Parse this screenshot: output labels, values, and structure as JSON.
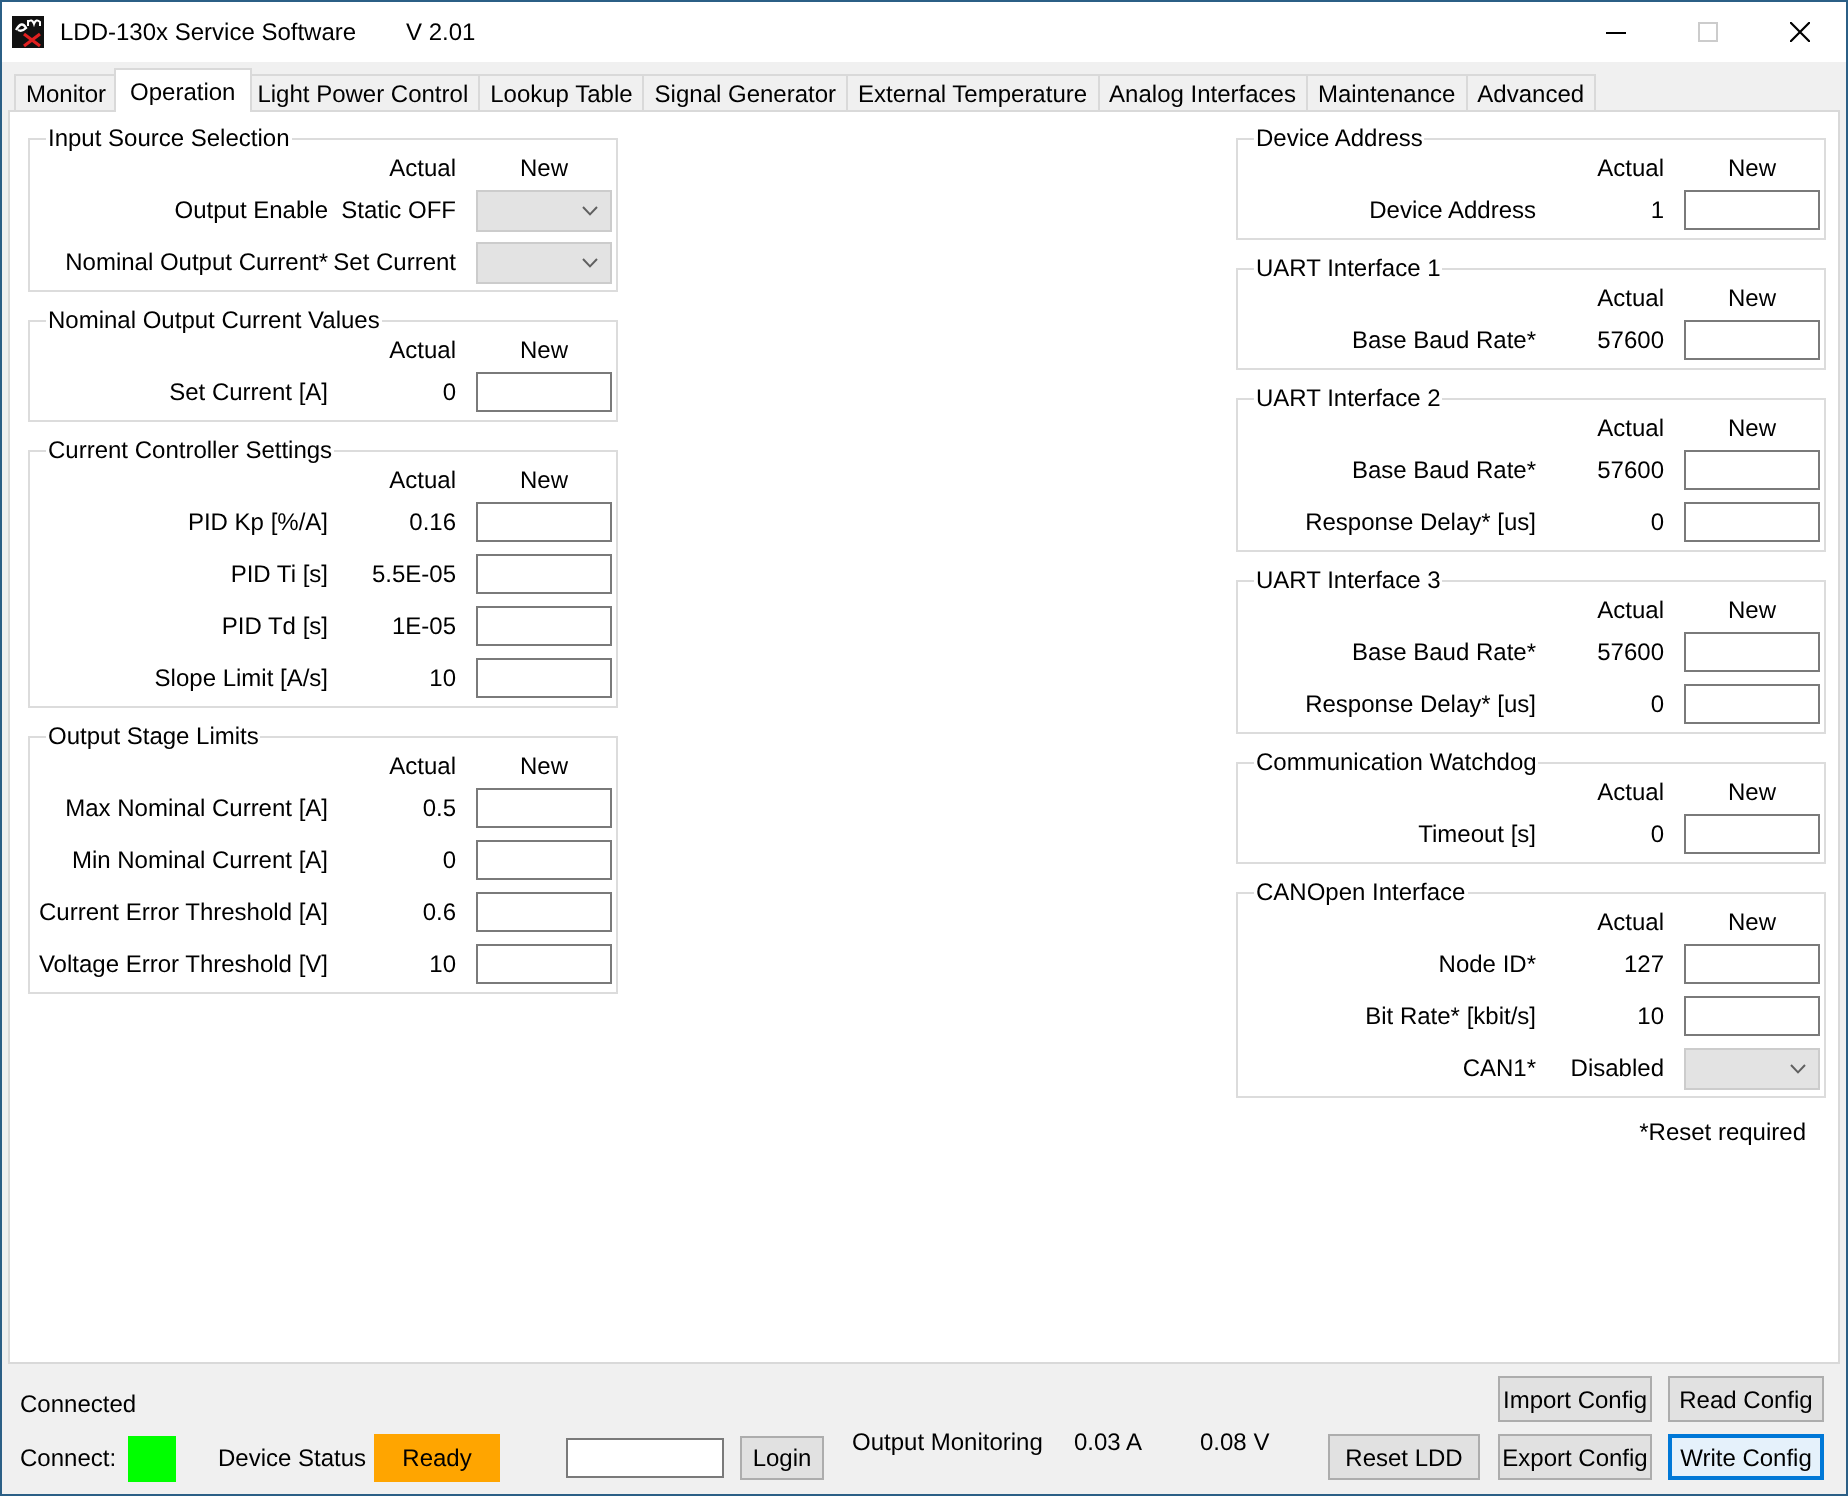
{
  "window": {
    "title": "LDD-130x Service Software",
    "version": "V 2.01",
    "maximize_enabled": false
  },
  "tabs": [
    {
      "label": "Monitor",
      "selected": false
    },
    {
      "label": "Operation",
      "selected": true
    },
    {
      "label": "Light Power Control",
      "selected": false
    },
    {
      "label": "Lookup Table",
      "selected": false
    },
    {
      "label": "Signal Generator",
      "selected": false
    },
    {
      "label": "External Temperature",
      "selected": false
    },
    {
      "label": "Analog Interfaces",
      "selected": false
    },
    {
      "label": "Maintenance",
      "selected": false
    },
    {
      "label": "Advanced",
      "selected": false
    }
  ],
  "left_groups": [
    {
      "title": "Input Source Selection",
      "headers": [
        "Actual",
        "New"
      ],
      "rows": [
        {
          "kind": "dropdown",
          "label": "Output Enable",
          "actual": "Static OFF",
          "disabled": true
        },
        {
          "kind": "dropdown",
          "label": "Nominal Output Current*",
          "actual": "Set Current",
          "disabled": true
        }
      ]
    },
    {
      "title": "Nominal Output Current Values",
      "headers": [
        "Actual",
        "New"
      ],
      "rows": [
        {
          "kind": "input",
          "label": "Set Current [A]",
          "actual": "0",
          "disabled": false
        }
      ]
    },
    {
      "title": "Current Controller Settings",
      "headers": [
        "Actual",
        "New"
      ],
      "rows": [
        {
          "kind": "input",
          "label": "PID Kp [%/A]",
          "actual": "0.16",
          "disabled": false
        },
        {
          "kind": "input",
          "label": "PID Ti [s]",
          "actual": "5.5E-05",
          "disabled": false
        },
        {
          "kind": "input",
          "label": "PID Td [s]",
          "actual": "1E-05",
          "disabled": false
        },
        {
          "kind": "input",
          "label": "Slope Limit [A/s]",
          "actual": "10",
          "disabled": false
        }
      ]
    },
    {
      "title": "Output Stage Limits",
      "headers": [
        "Actual",
        "New"
      ],
      "rows": [
        {
          "kind": "input",
          "label": "Max Nominal Current [A]",
          "actual": "0.5",
          "disabled": false
        },
        {
          "kind": "input",
          "label": "Min Nominal Current [A]",
          "actual": "0",
          "disabled": false
        },
        {
          "kind": "input",
          "label": "Current Error Threshold [A]",
          "actual": "0.6",
          "disabled": false
        },
        {
          "kind": "input",
          "label": "Voltage Error Threshold [V]",
          "actual": "10",
          "disabled": false
        }
      ]
    }
  ],
  "right_groups": [
    {
      "title": "Device Address",
      "headers": [
        "Actual",
        "New"
      ],
      "rows": [
        {
          "kind": "input",
          "label": "Device Address",
          "actual": "1",
          "disabled": false
        }
      ]
    },
    {
      "title": "UART Interface 1",
      "headers": [
        "Actual",
        "New"
      ],
      "rows": [
        {
          "kind": "input",
          "label": "Base Baud Rate*",
          "actual": "57600",
          "disabled": false
        }
      ]
    },
    {
      "title": "UART Interface 2",
      "headers": [
        "Actual",
        "New"
      ],
      "rows": [
        {
          "kind": "input",
          "label": "Base Baud Rate*",
          "actual": "57600",
          "disabled": false
        },
        {
          "kind": "input",
          "label": "Response Delay* [us]",
          "actual": "0",
          "disabled": false
        }
      ]
    },
    {
      "title": "UART Interface 3",
      "headers": [
        "Actual",
        "New"
      ],
      "rows": [
        {
          "kind": "input",
          "label": "Base Baud Rate*",
          "actual": "57600",
          "disabled": false
        },
        {
          "kind": "input",
          "label": "Response Delay* [us]",
          "actual": "0",
          "disabled": false
        }
      ]
    },
    {
      "title": "Communication Watchdog",
      "headers": [
        "Actual",
        "New"
      ],
      "rows": [
        {
          "kind": "input",
          "label": "Timeout [s]",
          "actual": "0",
          "disabled": false
        }
      ]
    },
    {
      "title": "CANOpen Interface",
      "headers": [
        "Actual",
        "New"
      ],
      "rows": [
        {
          "kind": "input",
          "label": "Node ID*",
          "actual": "127",
          "disabled": false
        },
        {
          "kind": "input",
          "label": "Bit Rate* [kbit/s]",
          "actual": "10",
          "disabled": false
        },
        {
          "kind": "dropdown",
          "label": "CAN1*",
          "actual": "Disabled",
          "disabled": true
        }
      ]
    }
  ],
  "footnote": "*Reset required",
  "status_bar": {
    "connection_status": "Connected",
    "connect_label": "Connect:",
    "connect_indicator": {
      "on": true
    },
    "device_status_label": "Device Status",
    "device_status": "Ready",
    "login_button": "Login",
    "output_monitoring_label": "Output Monitoring",
    "output_current": "0.03 A",
    "output_voltage": "0.08 V",
    "reset_button": {
      "label": "Reset LDD",
      "focused": false
    },
    "config_buttons": [
      {
        "label": "Import Config",
        "focused": false
      },
      {
        "label": "Read Config",
        "focused": false
      },
      {
        "label": "Export Config",
        "focused": false
      },
      {
        "label": "Write Config",
        "focused": true
      }
    ]
  }
}
